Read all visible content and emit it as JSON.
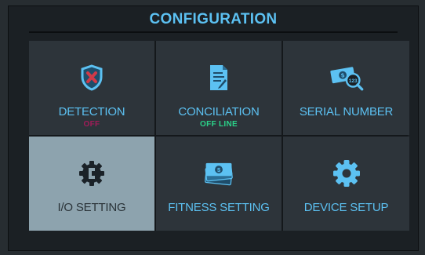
{
  "header": {
    "title": "CONFIGURATION"
  },
  "tiles": [
    {
      "label": "DETECTION",
      "status": "OFF",
      "icon": "shield-x-icon"
    },
    {
      "label": "CONCILIATION",
      "status": "OFF LINE",
      "icon": "document-sign-icon"
    },
    {
      "label": "SERIAL NUMBER",
      "icon": "banknote-search-icon"
    },
    {
      "label": "I/O SETTING",
      "icon": "gear-bracket-icon",
      "selected": true
    },
    {
      "label": "FITNESS SETTING",
      "icon": "banknote-stack-icon"
    },
    {
      "label": "DEVICE SETUP",
      "icon": "gear-icon"
    }
  ],
  "colors": {
    "accent": "#5cc1f2",
    "status_off": "#a01c58",
    "status_online": "#2bd38a",
    "selected_tile": "#8da3ae"
  }
}
